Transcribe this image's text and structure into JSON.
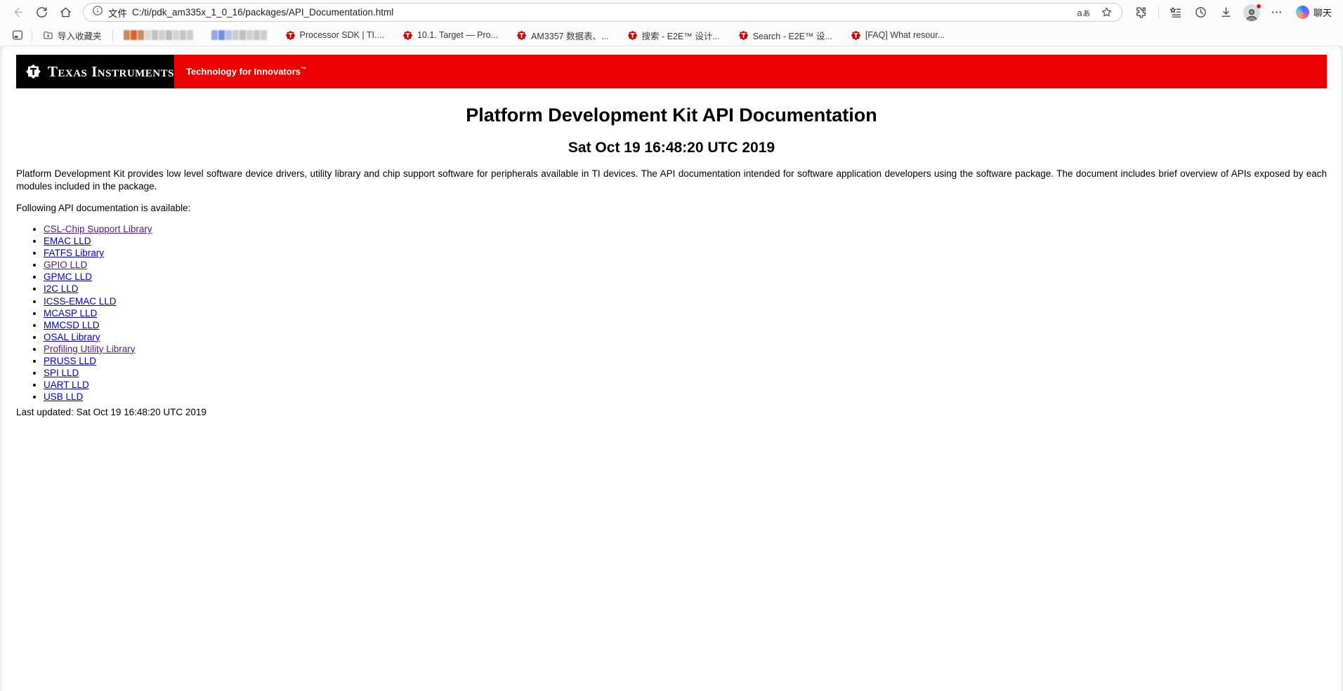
{
  "browser": {
    "toolbar": {
      "file_label": "文件",
      "url": "C:/ti/pdk_am335x_1_0_16/packages/API_Documentation.html",
      "translate_label": "aぁ",
      "copilot_label": "聊天"
    },
    "bookmarks_bar": {
      "import_label": "导入收藏夹",
      "items": [
        {
          "label": "",
          "favicon": "redacted-warm",
          "redacted": true
        },
        {
          "label": "",
          "favicon": "redacted-cool",
          "redacted": true
        },
        {
          "label": "Processor SDK | TI....",
          "favicon": "ti-logo"
        },
        {
          "label": "10.1. Target — Pro...",
          "favicon": "ti-logo"
        },
        {
          "label": "AM3357 数据表、...",
          "favicon": "ti-logo"
        },
        {
          "label": "搜索 - E2E™ 设计...",
          "favicon": "ti-logo"
        },
        {
          "label": "Search - E2E™ 设...",
          "favicon": "ti-logo"
        },
        {
          "label": "[FAQ] What resour...",
          "favicon": "ti-logo"
        }
      ]
    },
    "icons": {
      "back-icon": "←",
      "refresh-icon": "⟳",
      "home-icon": "⌂",
      "info-icon": "ⓘ",
      "add-favorite-icon": "☆",
      "extensions-icon": "puzzle-piece",
      "favorites-hub-icon": "star-with-lines",
      "history-icon": "clock",
      "downloads-icon": "down-arrow",
      "profile-icon": "person-with-red-dot",
      "more-icon": "⋯",
      "copilot-icon": "gradient-circle",
      "tab-sidebar-icon": "rounded-square",
      "import-folder-icon": "folder",
      "ti-favicon": "red-ti-bug"
    }
  },
  "banner": {
    "logo_text": "Texas Instruments",
    "tagline": "Technology for Innovators",
    "tagline_tm": "™",
    "colors": {
      "red": "#ec0000",
      "black": "#000000"
    }
  },
  "page": {
    "title": "Platform Development Kit API Documentation",
    "date_heading": "Sat Oct 19 16:48:20 UTC 2019",
    "intro": "Platform Development Kit provides low level software device drivers, utility library and chip support software for peripherals available in TI devices. The API documentation intended for software application developers using the software package. The document includes brief overview of APIs exposed by each modules included in the package.",
    "list_intro": "Following API documentation is available:",
    "links": [
      {
        "label": "CSL-Chip Support Library",
        "visited": true
      },
      {
        "label": "EMAC LLD",
        "visited": false
      },
      {
        "label": "FATFS Library",
        "visited": false
      },
      {
        "label": "GPIO LLD",
        "visited": true
      },
      {
        "label": "GPMC LLD",
        "visited": false
      },
      {
        "label": "I2C LLD",
        "visited": false
      },
      {
        "label": "ICSS-EMAC LLD",
        "visited": false
      },
      {
        "label": "MCASP LLD",
        "visited": false
      },
      {
        "label": "MMCSD LLD",
        "visited": false
      },
      {
        "label": "OSAL Library",
        "visited": false
      },
      {
        "label": "Profiling Utility Library",
        "visited": true
      },
      {
        "label": "PRUSS LLD",
        "visited": false
      },
      {
        "label": "SPI LLD",
        "visited": false
      },
      {
        "label": "UART LLD",
        "visited": false
      },
      {
        "label": "USB LLD",
        "visited": false
      }
    ],
    "last_updated": "Last updated: Sat Oct 19 16:48:20 UTC 2019",
    "link_colors": {
      "link": "#0000dd",
      "visited": "#551a8b"
    }
  }
}
